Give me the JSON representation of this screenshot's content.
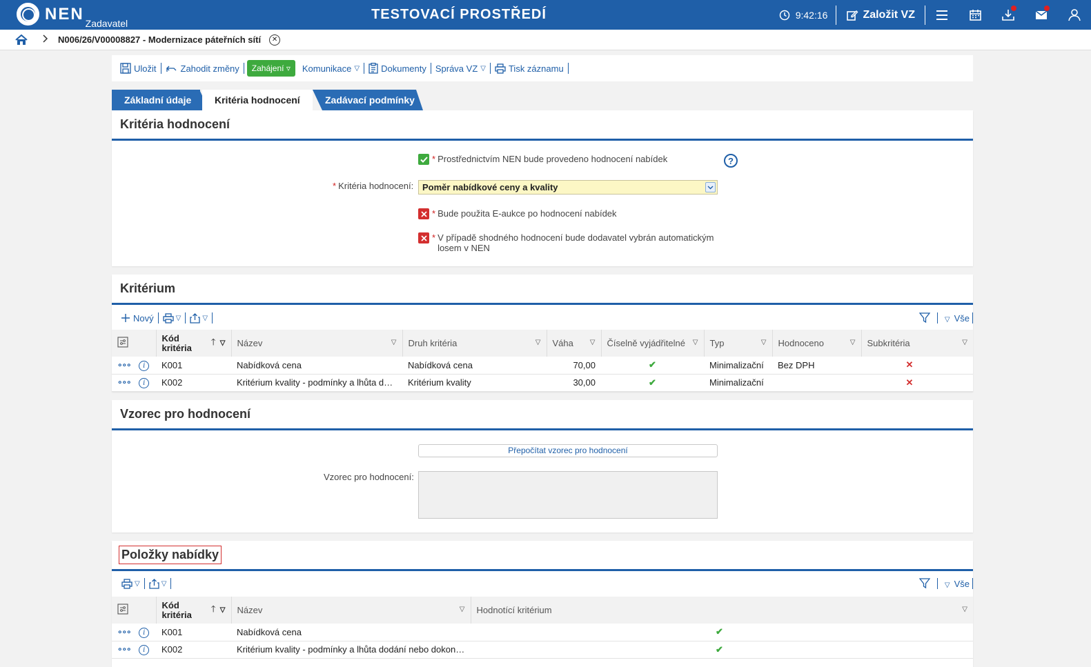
{
  "header": {
    "logo_text": "NEN",
    "logo_sub": "Zadavatel",
    "env_title": "TESTOVACÍ PROSTŘEDÍ",
    "time": "9:42:16",
    "create_label": "Založit VZ"
  },
  "breadcrumb": {
    "title": "N006/26/V00008827 - Modernizace páteřních sítí"
  },
  "toolbar": {
    "save": "Uložit",
    "discard": "Zahodit změny",
    "start": "Zahájení ▿",
    "communication": "Komunikace",
    "documents": "Dokumenty",
    "manage": "Správa VZ",
    "print": "Tisk záznamu"
  },
  "tabs": {
    "basic": "Základní údaje",
    "criteria": "Kritéria hodnocení",
    "conditions": "Zadávací podmínky"
  },
  "criteria_panel": {
    "title": "Kritéria hodnocení",
    "nen_eval": "Prostřednictvím NEN bude provedeno hodnocení nabídek",
    "criteria_label": "Kritéria hodnocení:",
    "criteria_value": "Poměr nabídkové ceny a kvality",
    "eauction": "Bude použita E-aukce po hodnocení nabídek",
    "tie_line1": "V případě shodného hodnocení bude dodavatel vybrán automatickým",
    "tie_line2": "losem v NEN"
  },
  "criterion_panel": {
    "title": "Kritérium",
    "new_label": "Nový",
    "all_label": "Vše",
    "columns": {
      "code": "Kód kritéria",
      "name": "Název",
      "kind": "Druh kritéria",
      "weight": "Váha",
      "numeric": "Číselně vyjádřitelné",
      "type": "Typ",
      "rated": "Hodnoceno",
      "sub": "Subkritéria"
    },
    "rows": [
      {
        "code": "K001",
        "name": "Nabídková cena",
        "kind": "Nabídková cena",
        "weight": "70,00",
        "type": "Minimalizační",
        "rated": "Bez DPH"
      },
      {
        "code": "K002",
        "name": "Kritérium kvality - podmínky a lhůta dodání nebo dokončení",
        "kind": "Kritérium kvality",
        "weight": "30,00",
        "type": "Minimalizační",
        "rated": ""
      }
    ]
  },
  "formula_panel": {
    "title": "Vzorec pro hodnocení",
    "recalc": "Přepočítat vzorec pro hodnocení",
    "formula_label": "Vzorec pro hodnocení:"
  },
  "items_panel": {
    "title": "Položky nabídky",
    "all_label": "Vše",
    "columns": {
      "code": "Kód kritéria",
      "name": "Název",
      "eval": "Hodnotící kritérium"
    },
    "rows": [
      {
        "code": "K001",
        "name": "Nabídková cena"
      },
      {
        "code": "K002",
        "name": "Kritérium kvality - podmínky a lhůta dodání nebo dokončení"
      }
    ]
  },
  "colors": {
    "primary": "#1f5fa8",
    "green": "#3eaa3e",
    "red": "#d32f2f"
  }
}
